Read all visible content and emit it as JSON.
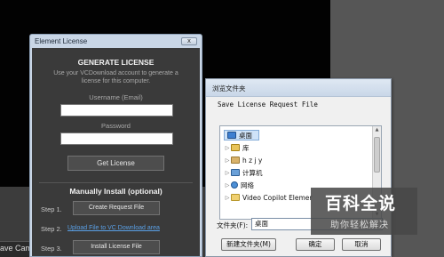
{
  "background": {
    "status_text": "ave Camera"
  },
  "license_window": {
    "title": "Element License",
    "close_label": "x",
    "heading": "GENERATE LICENSE",
    "description": "Use your VCDownload account to generate a license for this computer.",
    "username_label": "Username (Email)",
    "username_value": "",
    "password_label": "Password",
    "password_value": "",
    "get_license_button": "Get License",
    "manual_heading": "Manually Install (optional)",
    "steps": [
      {
        "label": "Step 1.",
        "action": "Create Request File"
      },
      {
        "label": "Step 2.",
        "action": "Upload File to VC Download area"
      },
      {
        "label": "Step 3.",
        "action": "Install License File"
      }
    ]
  },
  "save_dialog": {
    "title": "浏览文件夹",
    "caption": "Save License Request File",
    "tree": [
      {
        "label": "桌面",
        "icon": "desktop-icon",
        "selected": true
      },
      {
        "label": "库",
        "icon": "library-icon"
      },
      {
        "label": "h z j y",
        "icon": "user-folder-icon"
      },
      {
        "label": "计算机",
        "icon": "computer-icon"
      },
      {
        "label": "网络",
        "icon": "network-icon"
      },
      {
        "label": "Video Copilot Elemer",
        "icon": "folder-icon"
      }
    ],
    "filename_label": "文件夹(F):",
    "filename_value": "桌面",
    "new_folder_button": "新建文件夹(M)",
    "ok_button": "确定",
    "cancel_button": "取消"
  },
  "watermark": {
    "title": "百科全说",
    "subtitle": "助你轻松解决"
  }
}
